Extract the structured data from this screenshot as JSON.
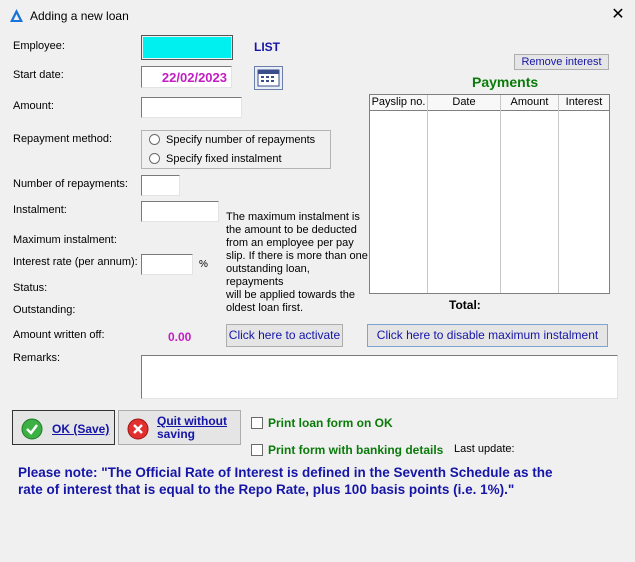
{
  "window": {
    "title": "Adding a new loan",
    "close_symbol": "✕"
  },
  "form": {
    "employee_label": "Employee:",
    "list_link": "LIST",
    "start_date_label": "Start date:",
    "start_date_value": "22/02/2023",
    "amount_label": "Amount:",
    "repayment_method_label": "Repayment method:",
    "radio_number": "Specify number of repayments",
    "radio_fixed": "Specify fixed instalment",
    "num_repayments_label": "Number of repayments:",
    "instalment_label": "Instalment:",
    "max_instalment_label": "Maximum instalment:",
    "interest_rate_label": "Interest rate (per annum):",
    "percent": "%",
    "status_label": "Status:",
    "outstanding_label": "Outstanding:",
    "written_off_label": "Amount written off:",
    "written_off_value": "0.00",
    "remarks_label": "Remarks:",
    "note_lines": [
      "The maximum instalment is",
      "the amount to be deducted",
      "from an employee per pay",
      "slip. If there is more than one",
      "outstanding loan, repayments",
      "will be applied towards the",
      "oldest loan first."
    ]
  },
  "payments": {
    "remove_interest": "Remove interest",
    "title": "Payments",
    "columns": [
      "Payslip no.",
      "Date",
      "Amount",
      "Interest"
    ],
    "total_label": "Total:"
  },
  "buttons": {
    "activate": "Click here to activate",
    "disable_max": "Click here to disable maximum instalment",
    "ok_save": "OK (Save)",
    "quit_line1": "Quit without",
    "quit_line2": "saving",
    "print_loan": "Print loan form on OK",
    "print_banking": "Print form with banking details",
    "last_update": "Last update:"
  },
  "notice": {
    "line1": "Please note: \"The Official Rate of Interest is defined in the Seventh Schedule as the",
    "line2": "rate of interest that is equal to the Repo Rate, plus 100 basis points (i.e. 1%).\""
  },
  "colors": {
    "accent_blue": "#1515a8",
    "date_magenta": "#c21ec2",
    "green": "#0a7a0a",
    "employee_cyan": "#00f0f0"
  }
}
